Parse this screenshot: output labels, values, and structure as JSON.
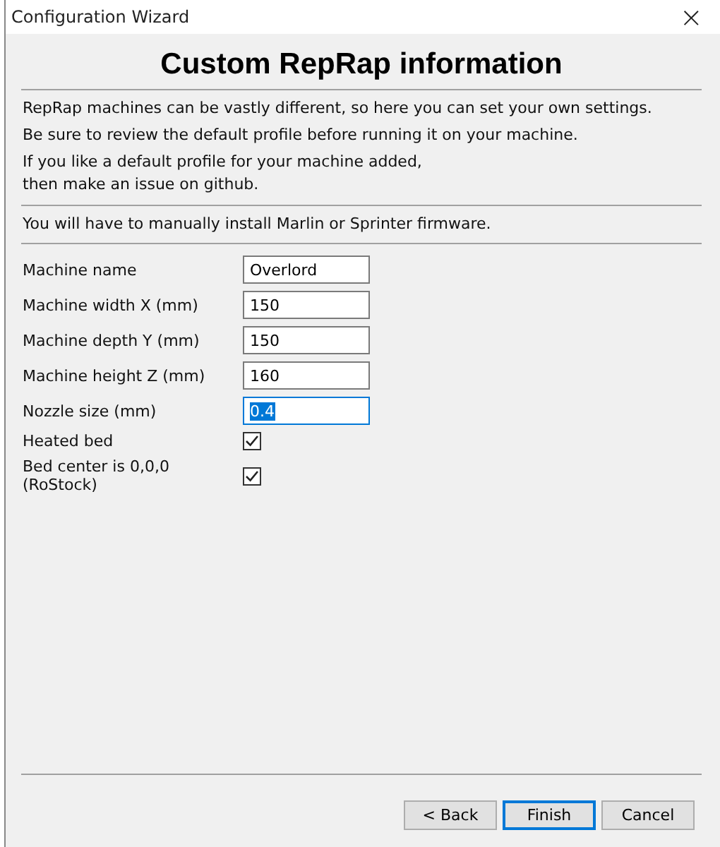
{
  "window": {
    "title": "Configuration Wizard",
    "close": "×"
  },
  "heading": "Custom RepRap information",
  "intro": [
    "RepRap machines can be vastly different, so here you can set your own settings.",
    "Be sure to review the default profile before running it on your machine.",
    "If you like a default profile for your machine added,\nthen make an issue on github."
  ],
  "note": "You will have to manually install Marlin or Sprinter firmware.",
  "fields": [
    {
      "kind": "text",
      "label": "Machine name",
      "value": "Overlord",
      "focused": false
    },
    {
      "kind": "text",
      "label": "Machine width X (mm)",
      "value": "150",
      "focused": false
    },
    {
      "kind": "text",
      "label": "Machine depth Y (mm)",
      "value": "150",
      "focused": false
    },
    {
      "kind": "text",
      "label": "Machine height Z (mm)",
      "value": "160",
      "focused": false
    },
    {
      "kind": "text",
      "label": "Nozzle size (mm)",
      "value": "0.4",
      "focused": true
    },
    {
      "kind": "checkbox",
      "label": "Heated bed",
      "checked": true
    },
    {
      "kind": "checkbox",
      "label": "Bed center is 0,0,0 (RoStock)",
      "checked": true
    }
  ],
  "buttons": [
    {
      "label": "< Back",
      "default": false
    },
    {
      "label": "Finish",
      "default": true
    },
    {
      "label": "Cancel",
      "default": false
    }
  ]
}
